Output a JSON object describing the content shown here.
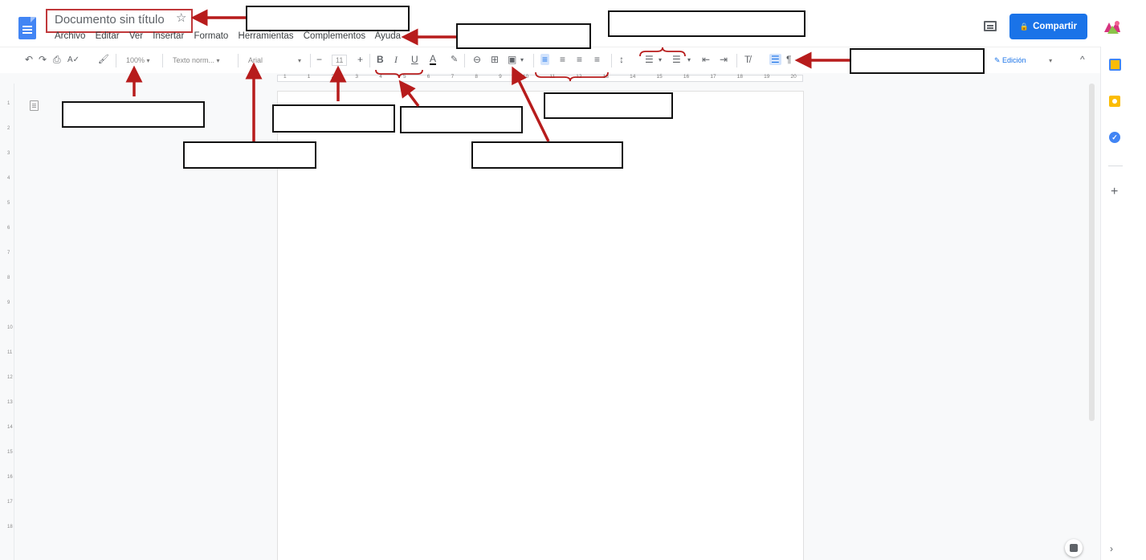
{
  "header": {
    "doc_title": "Documento sin título",
    "star_icon": "☆",
    "menu": [
      "Archivo",
      "Editar",
      "Ver",
      "Insertar",
      "Formato",
      "Herramientas",
      "Complementos",
      "Ayuda"
    ],
    "share_label": "Compartir",
    "share_lock_icon": "🔒"
  },
  "toolbar": {
    "undo_icon": "↶",
    "redo_icon": "↷",
    "print_icon": "⎙",
    "spellcheck_icon": "A✓",
    "paint_format_icon": "🖌",
    "zoom": "100%",
    "style": "Texto norm...",
    "font": "Arial",
    "font_size_minus": "−",
    "font_size": "11",
    "font_size_plus": "+",
    "bold": "B",
    "italic": "I",
    "underline": "U",
    "text_color": "A",
    "highlight_icon": "✎",
    "link_icon": "⊖",
    "comment_icon": "⊞",
    "image_icon": "▣",
    "align_left_icon": "≡",
    "align_center_icon": "≡",
    "align_right_icon": "≡",
    "align_justify_icon": "≡",
    "line_spacing_icon": "↕",
    "checklist_icon": "☰",
    "numbered_list_icon": "☰",
    "bulleted_list_icon": "☰",
    "indent_decrease_icon": "⇤",
    "indent_increase_icon": "⇥",
    "clear_format_icon": "T̸",
    "mode_label": "Edición",
    "collapse_icon": "^"
  },
  "ruler": {
    "numbers": [
      "1",
      "1",
      "2",
      "3",
      "4",
      "5",
      "6",
      "7",
      "8",
      "9",
      "10",
      "11",
      "12",
      "13",
      "14",
      "15",
      "16",
      "17",
      "18",
      "19",
      "20"
    ]
  },
  "left_ruler": {
    "numbers": [
      "1",
      "2",
      "3",
      "4",
      "5",
      "6",
      "7",
      "8",
      "9",
      "10",
      "11",
      "12",
      "13",
      "14",
      "15",
      "16",
      "17",
      "18"
    ]
  },
  "side_panel": {
    "addons_icon": "+",
    "expand_icon": "›"
  },
  "colors": {
    "brand_blue": "#1a73e8",
    "docs_blue": "#4285f4",
    "annotation_red": "#b71c1c",
    "keep_yellow": "#fbbc04"
  }
}
